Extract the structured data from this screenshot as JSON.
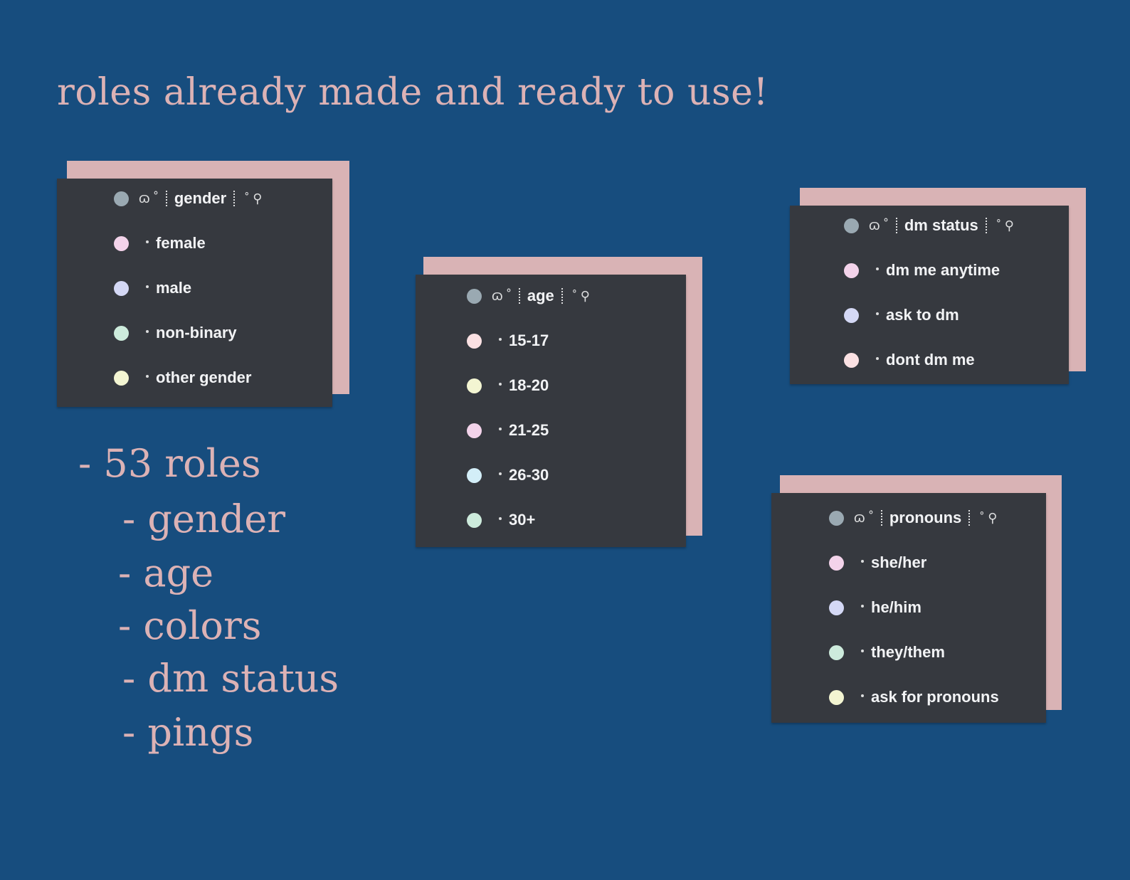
{
  "title": "roles already made and ready to use!",
  "summary": {
    "lines": [
      "- 53 roles",
      "- gender",
      "- age",
      "- colors",
      "- dm status",
      "- pings"
    ]
  },
  "colors": {
    "background": "#174d7e",
    "accent": "#dcb2b5",
    "card": "#36393f",
    "header_dot": "#9aa9b2"
  },
  "decor": {
    "left": "ɷ ˚",
    "right": "˚ ⚲"
  },
  "cards": {
    "gender": {
      "header": "gender",
      "items": [
        {
          "label": "female",
          "color": "#f3d3ea"
        },
        {
          "label": "male",
          "color": "#d4d8f5"
        },
        {
          "label": "non-binary",
          "color": "#cdebdc"
        },
        {
          "label": "other gender",
          "color": "#f3f5d2"
        }
      ]
    },
    "age": {
      "header": "age",
      "items": [
        {
          "label": "15-17",
          "color": "#fbe1e3"
        },
        {
          "label": "18-20",
          "color": "#f3f5d2"
        },
        {
          "label": "21-25",
          "color": "#f3d3ea"
        },
        {
          "label": "26-30",
          "color": "#d3eef8"
        },
        {
          "label": "30+",
          "color": "#cdebdc"
        }
      ]
    },
    "dm": {
      "header": "dm status",
      "items": [
        {
          "label": "dm me anytime",
          "color": "#f3d3ea"
        },
        {
          "label": "ask to dm",
          "color": "#d4d8f5"
        },
        {
          "label": "dont dm me",
          "color": "#fbe1e3"
        }
      ]
    },
    "pronouns": {
      "header": "pronouns",
      "items": [
        {
          "label": "she/her",
          "color": "#f3d3ea"
        },
        {
          "label": "he/him",
          "color": "#d4d8f5"
        },
        {
          "label": "they/them",
          "color": "#cdebdc"
        },
        {
          "label": "ask for pronouns",
          "color": "#f3f5d2"
        }
      ]
    }
  }
}
